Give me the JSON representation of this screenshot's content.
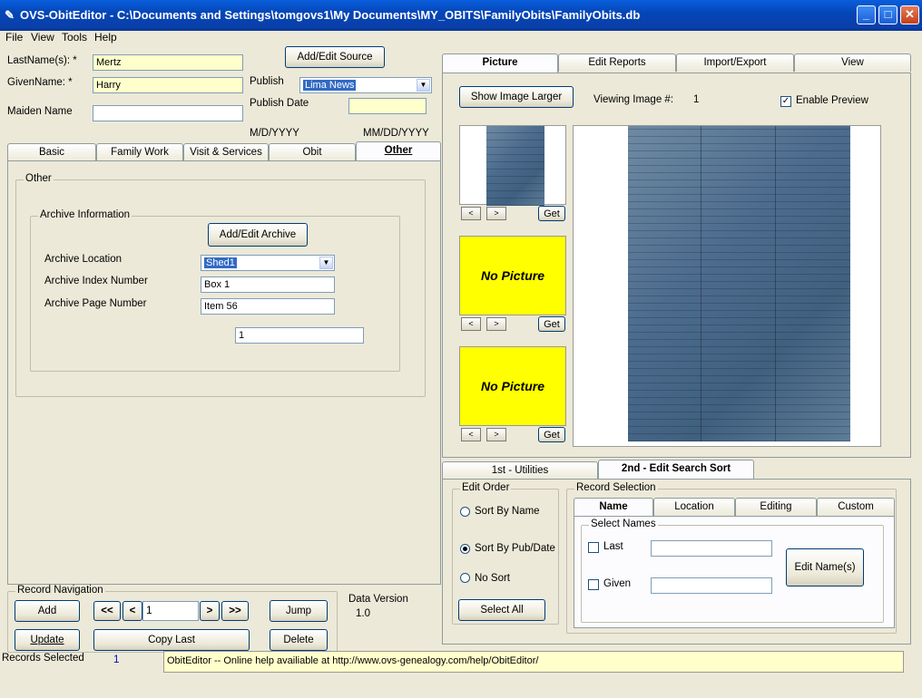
{
  "window": {
    "title": "OVS-ObitEditor  - C:\\Documents and Settings\\tomgovs1\\My Documents\\MY_OBITS\\FamilyObits\\FamilyObits.db"
  },
  "menu": [
    "File",
    "View",
    "Tools",
    "Help"
  ],
  "person": {
    "lastname_label": "LastName(s): *",
    "lastname_value": "Mertz",
    "givenname_label": "GivenName: *",
    "givenname_value": "Harry",
    "maiden_label": "Maiden Name",
    "maiden_value": "",
    "add_edit_source": "Add/Edit Source",
    "publish_label": "Publish",
    "publish_value": "Lima News",
    "publish_date_label": "Publish Date",
    "publish_date_value": "",
    "date_fmt_1": "M/D/YYYY",
    "date_fmt_2": "MM/DD/YYYY"
  },
  "left_tabs": [
    "Basic",
    "Family Work",
    "Visit & Services",
    "Obit",
    "Other"
  ],
  "other": {
    "group_title": "Other",
    "archive_group_title": "Archive Information",
    "add_edit_archive": "Add/Edit Archive",
    "archive_location_label": "Archive Location",
    "archive_location_value": "Shed1",
    "archive_index_label": "Archive Index Number",
    "archive_index_value": "Box 1",
    "archive_page_label": "Archive Page Number",
    "archive_page_value": "Item 56",
    "extra_value": "1"
  },
  "right_tabs": [
    "Picture",
    "Edit Reports",
    "Import/Export",
    "View"
  ],
  "picture": {
    "show_larger": "Show Image Larger",
    "viewing_label": "Viewing Image #:",
    "viewing_value": "1",
    "enable_preview": "Enable Preview",
    "no_picture": "No Picture",
    "get": "Get",
    "prev": "<",
    "next": ">"
  },
  "bottom_tabs": [
    "1st - Utilities",
    "2nd - Edit Search Sort"
  ],
  "edit_order": {
    "title": "Edit Order",
    "sort_name": "Sort By Name",
    "sort_pub": "Sort By Pub/Date",
    "no_sort": "No Sort",
    "select_all": "Select All"
  },
  "record_selection": {
    "title": "Record Selection",
    "tabs": [
      "Name",
      "Location",
      "Editing",
      "Custom"
    ],
    "select_names": "Select Names",
    "last": "Last",
    "given": "Given",
    "edit_names": "Edit Name(s)"
  },
  "nav": {
    "title": "Record Navigation",
    "add": "Add",
    "first": "<<",
    "prev": "<",
    "record_value": "1",
    "next": ">",
    "last": ">>",
    "jump": "Jump",
    "update": "Update",
    "copy_last": "Copy Last",
    "delete": "Delete",
    "data_version_label": "Data Version",
    "data_version_value": "1.0"
  },
  "status": {
    "records_selected_label": "Records Selected",
    "records_selected_value": "1",
    "message": "ObitEditor -- Online help availiable at http://www.ovs-genealogy.com/help/ObitEditor/"
  }
}
